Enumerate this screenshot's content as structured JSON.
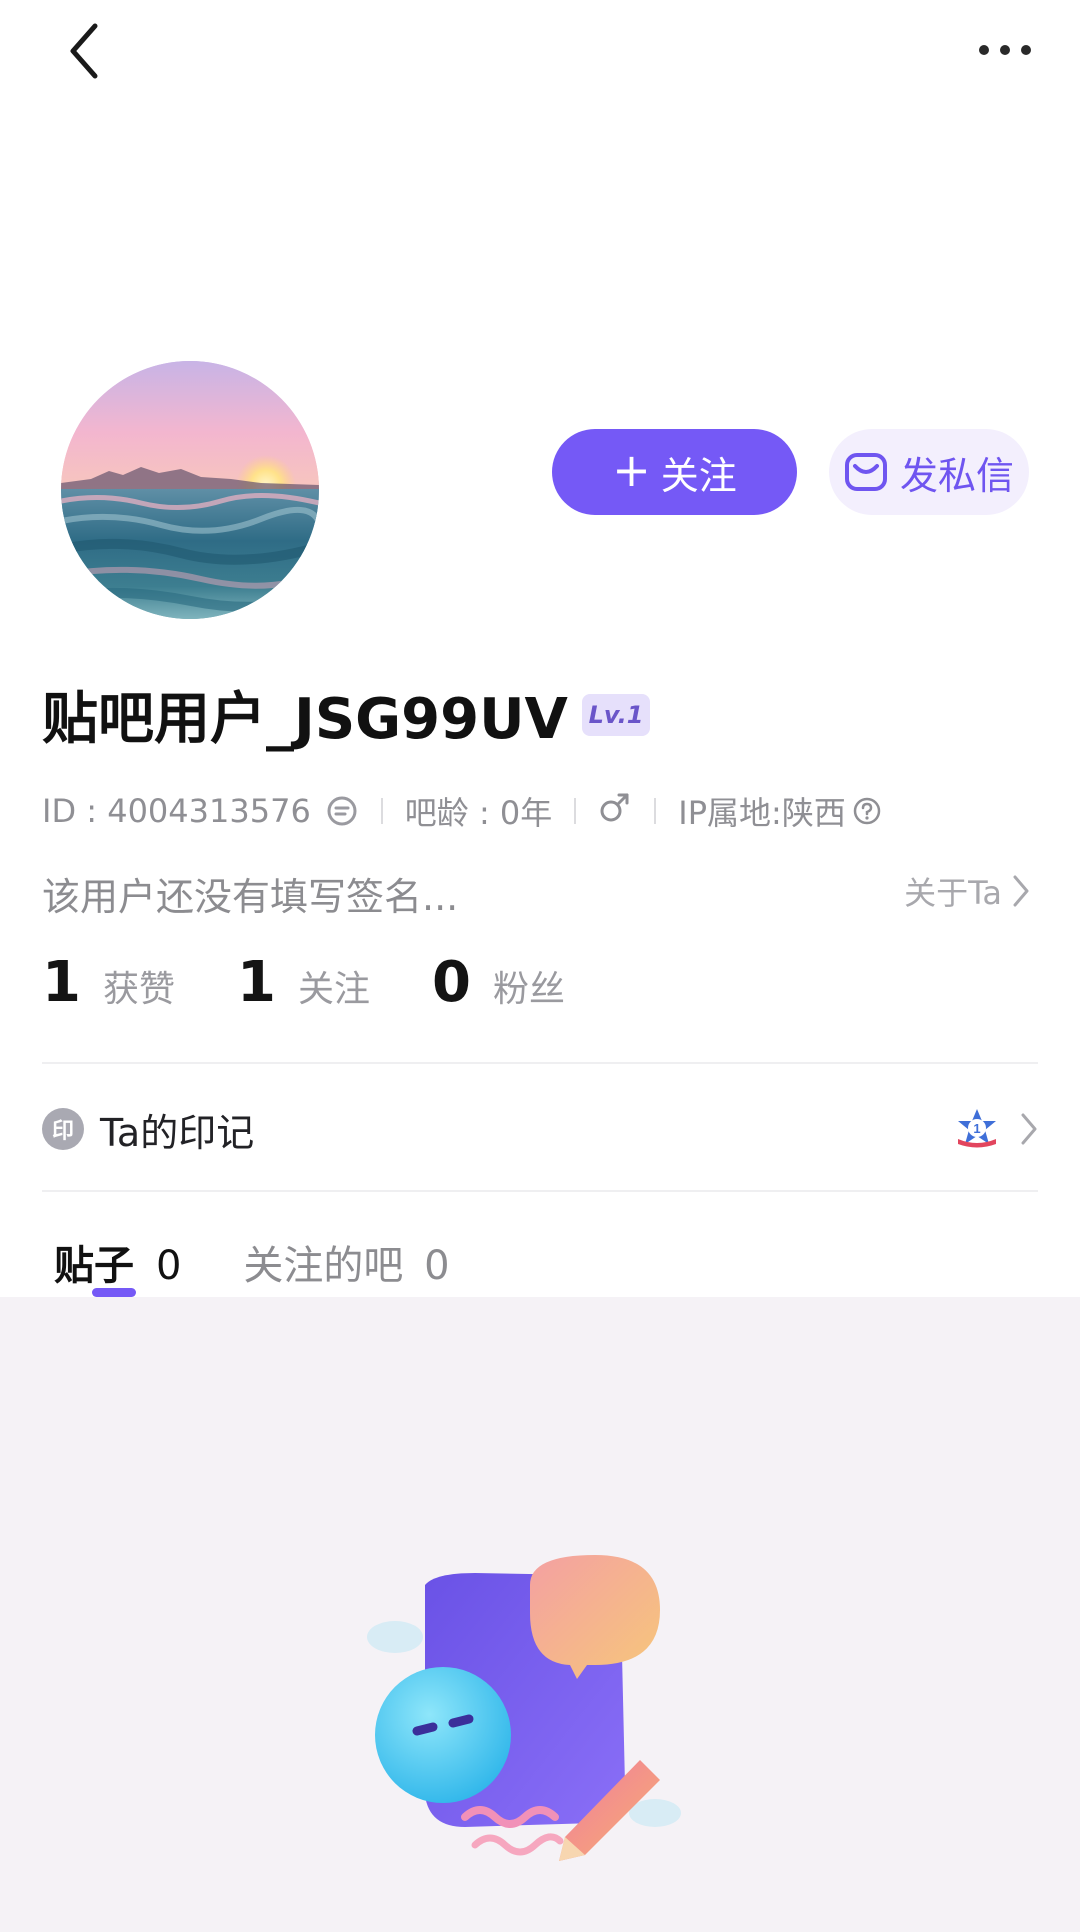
{
  "topbar": {
    "back_icon": "chevron-left-icon",
    "more_icon": "more-horizontal-icon"
  },
  "actions": {
    "follow_label": "关注",
    "follow_icon": "plus-icon",
    "message_label": "发私信",
    "message_icon": "envelope-icon"
  },
  "profile": {
    "username": "贴吧用户_JSG99UV",
    "level": "Lv.1",
    "id_text": "ID : 4004313576",
    "bar_age": "吧龄 : 0年",
    "gender_icon": "male-icon",
    "ip_location": "IP属地:陕西",
    "signature": "该用户还没有填写签名...",
    "about_label": "关于Ta"
  },
  "stats": [
    {
      "num": "1",
      "label": "获赞"
    },
    {
      "num": "1",
      "label": "关注"
    },
    {
      "num": "0",
      "label": "粉丝"
    }
  ],
  "imprint": {
    "icon_text": "印",
    "label": "Ta的印记"
  },
  "tabs": [
    {
      "label": "贴子",
      "count": "0"
    },
    {
      "label": "关注的吧",
      "count": "0"
    }
  ],
  "colors": {
    "accent": "#7559f6",
    "accent_light": "#f3effd",
    "content_bg": "#f5f2f6"
  }
}
